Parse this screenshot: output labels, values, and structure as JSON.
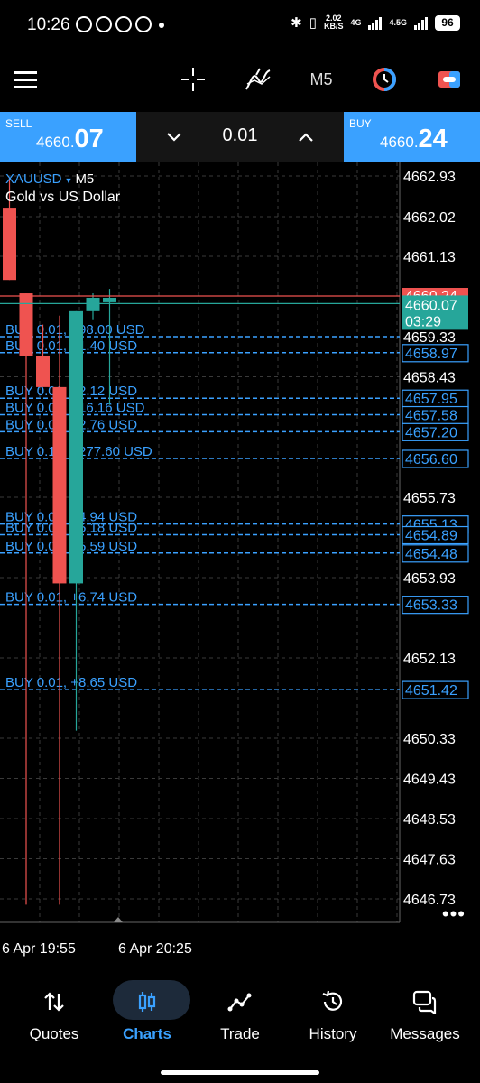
{
  "status_bar": {
    "time": "10:26",
    "net_speed": "2.02",
    "net_unit": "KB/S",
    "net1": "4G",
    "net2": "4.5G",
    "battery": "96"
  },
  "toolbar": {
    "timeframe": "M5"
  },
  "trade": {
    "sell_label": "SELL",
    "sell_price_main": "4660.",
    "sell_price_big": "07",
    "lot_value": "0.01",
    "buy_label": "BUY",
    "buy_price_main": "4660.",
    "buy_price_big": "24"
  },
  "chart": {
    "symbol": "XAUUSD",
    "timeframe": "M5",
    "description": "Gold vs US Dollar",
    "bid_tag": "4660.07",
    "countdown": "03:29",
    "ask_tag": "4660.24",
    "more": "•••",
    "colors": {
      "bull": "#26a69a",
      "bear": "#ef5350",
      "line": "#3aa1ff"
    }
  },
  "chart_data": {
    "type": "candlestick",
    "title": "XAUUSD",
    "subtitle": "Gold vs US Dollar",
    "timeframe": "M5",
    "y_ticks": [
      "4662.93",
      "4662.02",
      "4661.13",
      "4659.33",
      "4658.43",
      "4655.73",
      "4653.93",
      "4652.13",
      "4650.33",
      "4649.43",
      "4648.53",
      "4647.63",
      "4646.73"
    ],
    "x_ticks": [
      "6 Apr 19:55",
      "6 Apr 20:25"
    ],
    "ylim": [
      4646.2,
      4663.4
    ],
    "candles": [
      {
        "open": 4662.2,
        "high": 4662.9,
        "low": 4660.6,
        "close": 4660.6,
        "dir": "bear"
      },
      {
        "open": 4660.3,
        "high": 4660.3,
        "low": 4646.6,
        "close": 4658.9,
        "dir": "bear"
      },
      {
        "open": 4658.9,
        "high": 4659.6,
        "low": 4658.3,
        "close": 4658.2,
        "dir": "bear"
      },
      {
        "open": 4658.2,
        "high": 4659.8,
        "low": 4646.6,
        "close": 4653.8,
        "dir": "bear"
      },
      {
        "open": 4653.8,
        "high": 4659.9,
        "low": 4650.5,
        "close": 4659.9,
        "dir": "bull"
      },
      {
        "open": 4659.9,
        "high": 4660.3,
        "low": 4659.7,
        "close": 4660.2,
        "dir": "bull"
      },
      {
        "open": 4660.2,
        "high": 4660.4,
        "low": 4657.8,
        "close": 4660.1,
        "dir": "bull"
      }
    ],
    "current_bid": 4660.07,
    "current_ask": 4660.24,
    "open_positions": [
      {
        "label": "BUY 0.01, +98.00 USD",
        "price": 4659.33
      },
      {
        "label": "BUY 0.01, +1.40 USD",
        "price": 4658.97
      },
      {
        "label": "BUY 0.01, +2.12 USD",
        "price": 4657.95
      },
      {
        "label": "BUY 0.01, +16.16 USD",
        "price": 4657.58
      },
      {
        "label": "BUY 0.01, +2.76 USD",
        "price": 4657.2
      },
      {
        "label": "BUY 0.10, +277.60 USD",
        "price": 4656.6
      },
      {
        "label": "BUY 0.01, +4.94 USD",
        "price": 4655.13
      },
      {
        "label": "BUY 0.01, +5.18 USD",
        "price": 4654.89
      },
      {
        "label": "BUY 0.01, +5.59 USD",
        "price": 4654.48
      },
      {
        "label": "BUY 0.01, +6.74 USD",
        "price": 4653.33
      },
      {
        "label": "BUY 0.01, +8.65 USD",
        "price": 4651.42
      }
    ],
    "right_price_tags": [
      "4658.97",
      "4657.95",
      "4657.58",
      "4657.20",
      "4656.60",
      "4655.13",
      "4654.89",
      "4654.48",
      "4653.33",
      "4651.42"
    ]
  },
  "nav": {
    "items": [
      {
        "label": "Quotes"
      },
      {
        "label": "Charts"
      },
      {
        "label": "Trade"
      },
      {
        "label": "History"
      },
      {
        "label": "Messages"
      }
    ]
  }
}
